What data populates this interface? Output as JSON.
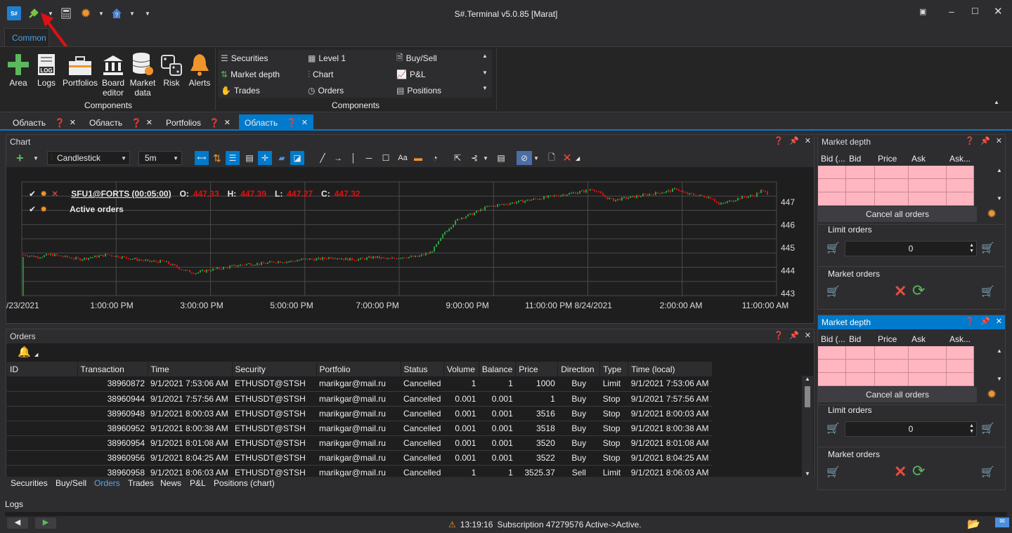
{
  "window": {
    "title": "S#.Terminal v5.0.85 [Marat]"
  },
  "ribbon": {
    "tab_label": "Common",
    "big_buttons": [
      "Area",
      "Logs",
      "Portfolios",
      "Board editor",
      "Market data",
      "Risk",
      "Alerts"
    ],
    "components_left_label": "Components",
    "small_buttons_col1": [
      "Securities",
      "Market depth",
      "Trades"
    ],
    "small_buttons_col2": [
      "Level 1",
      "Chart",
      "Orders"
    ],
    "small_buttons_col3": [
      "Buy/Sell",
      "P&L",
      "Positions"
    ],
    "components_right_label": "Components"
  },
  "doc_tabs": [
    "Область",
    "Область",
    "Portfolios",
    "Область"
  ],
  "chart": {
    "panel_title": "Chart",
    "chart_type": "Candlestick",
    "timeframe": "5m",
    "series_label": "SFU1@FORTS (00:05:00)",
    "ohlc": {
      "O_label": "O:",
      "O": "447.33",
      "H_label": "H:",
      "H": "447.39",
      "L_label": "L:",
      "L": "447.27",
      "C_label": "C:",
      "C": "447.32"
    },
    "orders_label": "Active orders"
  },
  "chart_data": {
    "type": "candlestick",
    "title": "SFU1@FORTS (00:05:00)",
    "x_ticks": [
      "/23/2021",
      "1:00:00 PM",
      "3:00:00 PM",
      "5:00:00 PM",
      "7:00:00 PM",
      "9:00:00 PM",
      "11:00:00 PM 8/24/2021",
      "2:00:00 AM",
      "11:00:00 AM"
    ],
    "y_ticks": [
      "447",
      "446",
      "445",
      "444",
      "443"
    ],
    "ylim": [
      442.9,
      447.9
    ],
    "close_path": [
      [
        0,
        444.7
      ],
      [
        20,
        444.6
      ],
      [
        40,
        444.7
      ],
      [
        60,
        444.6
      ],
      [
        80,
        444.5
      ],
      [
        100,
        444.6
      ],
      [
        120,
        444.7
      ],
      [
        140,
        444.6
      ],
      [
        160,
        444.5
      ],
      [
        180,
        444.4
      ],
      [
        200,
        444.4
      ],
      [
        215,
        444.2
      ],
      [
        230,
        444.0
      ],
      [
        245,
        443.9
      ],
      [
        260,
        444.0
      ],
      [
        280,
        444.1
      ],
      [
        300,
        444.2
      ],
      [
        320,
        444.3
      ],
      [
        340,
        444.3
      ],
      [
        360,
        444.4
      ],
      [
        380,
        444.4
      ],
      [
        400,
        444.5
      ],
      [
        420,
        444.5
      ],
      [
        440,
        444.6
      ],
      [
        460,
        444.5
      ],
      [
        480,
        444.5
      ],
      [
        500,
        444.6
      ],
      [
        520,
        444.5
      ],
      [
        540,
        444.6
      ],
      [
        560,
        444.6
      ],
      [
        580,
        444.8
      ],
      [
        590,
        445.2
      ],
      [
        600,
        445.7
      ],
      [
        610,
        446.0
      ],
      [
        620,
        446.3
      ],
      [
        640,
        446.5
      ],
      [
        660,
        446.8
      ],
      [
        680,
        446.9
      ],
      [
        700,
        447.0
      ],
      [
        720,
        447.1
      ],
      [
        740,
        447.2
      ],
      [
        760,
        447.3
      ],
      [
        780,
        447.4
      ],
      [
        800,
        447.5
      ],
      [
        810,
        447.6
      ],
      [
        820,
        447.4
      ],
      [
        830,
        447.2
      ],
      [
        840,
        447.1
      ],
      [
        860,
        447.2
      ],
      [
        880,
        447.3
      ],
      [
        900,
        447.4
      ],
      [
        920,
        447.5
      ],
      [
        930,
        447.6
      ],
      [
        940,
        447.4
      ],
      [
        960,
        447.3
      ],
      [
        980,
        447.2
      ],
      [
        990,
        446.9
      ],
      [
        1000,
        447.0
      ],
      [
        1020,
        447.2
      ],
      [
        1040,
        447.3
      ],
      [
        1050,
        447.5
      ],
      [
        1060,
        447.4
      ]
    ]
  },
  "orders": {
    "panel_title": "Orders",
    "columns": [
      "ID",
      "Transaction",
      "Time",
      "Security",
      "Portfolio",
      "Status",
      "Volume",
      "Balance",
      "Price",
      "Direction",
      "Type",
      "Time (local)"
    ],
    "rows": [
      [
        "",
        "38960872",
        "9/1/2021 7:53:06 AM",
        "ETHUSDT@STSH",
        "marikgar@mail.ru",
        "Cancelled",
        "1",
        "1",
        "1000",
        "Buy",
        "Limit",
        "9/1/2021 7:53:06 AM"
      ],
      [
        "",
        "38960944",
        "9/1/2021 7:57:56 AM",
        "ETHUSDT@STSH",
        "marikgar@mail.ru",
        "Cancelled",
        "0.001",
        "0.001",
        "1",
        "Buy",
        "Stop",
        "9/1/2021 7:57:56 AM"
      ],
      [
        "",
        "38960948",
        "9/1/2021 8:00:03 AM",
        "ETHUSDT@STSH",
        "marikgar@mail.ru",
        "Cancelled",
        "0.001",
        "0.001",
        "3516",
        "Buy",
        "Stop",
        "9/1/2021 8:00:03 AM"
      ],
      [
        "",
        "38960952",
        "9/1/2021 8:00:38 AM",
        "ETHUSDT@STSH",
        "marikgar@mail.ru",
        "Cancelled",
        "0.001",
        "0.001",
        "3518",
        "Buy",
        "Stop",
        "9/1/2021 8:00:38 AM"
      ],
      [
        "",
        "38960954",
        "9/1/2021 8:01:08 AM",
        "ETHUSDT@STSH",
        "marikgar@mail.ru",
        "Cancelled",
        "0.001",
        "0.001",
        "3520",
        "Buy",
        "Stop",
        "9/1/2021 8:01:08 AM"
      ],
      [
        "",
        "38960956",
        "9/1/2021 8:04:25 AM",
        "ETHUSDT@STSH",
        "marikgar@mail.ru",
        "Cancelled",
        "0.001",
        "0.001",
        "3522",
        "Buy",
        "Stop",
        "9/1/2021 8:04:25 AM"
      ],
      [
        "",
        "38960958",
        "9/1/2021 8:06:03 AM",
        "ETHUSDT@STSH",
        "marikgar@mail.ru",
        "Cancelled",
        "1",
        "1",
        "3525.37",
        "Sell",
        "Limit",
        "9/1/2021 8:06:03 AM"
      ]
    ],
    "bottom_tabs": [
      "Securities",
      "Buy/Sell",
      "Orders",
      "Trades",
      "News",
      "P&L",
      "Positions (chart)"
    ]
  },
  "market_depth": {
    "title": "Market depth",
    "columns": [
      "Bid (...",
      "Bid",
      "Price",
      "Ask",
      "Ask..."
    ],
    "cancel_all": "Cancel all orders",
    "limit_orders": "Limit orders",
    "limit_value": "0",
    "market_orders": "Market orders"
  },
  "logs": {
    "title": "Logs",
    "status_time": "13:19:16",
    "status_message": "Subscription 47279576 Active->Active."
  },
  "colors": {
    "accent": "#007acc",
    "up": "#2ea043",
    "down": "#e01010",
    "depth_cell": "#ffb6c1"
  }
}
